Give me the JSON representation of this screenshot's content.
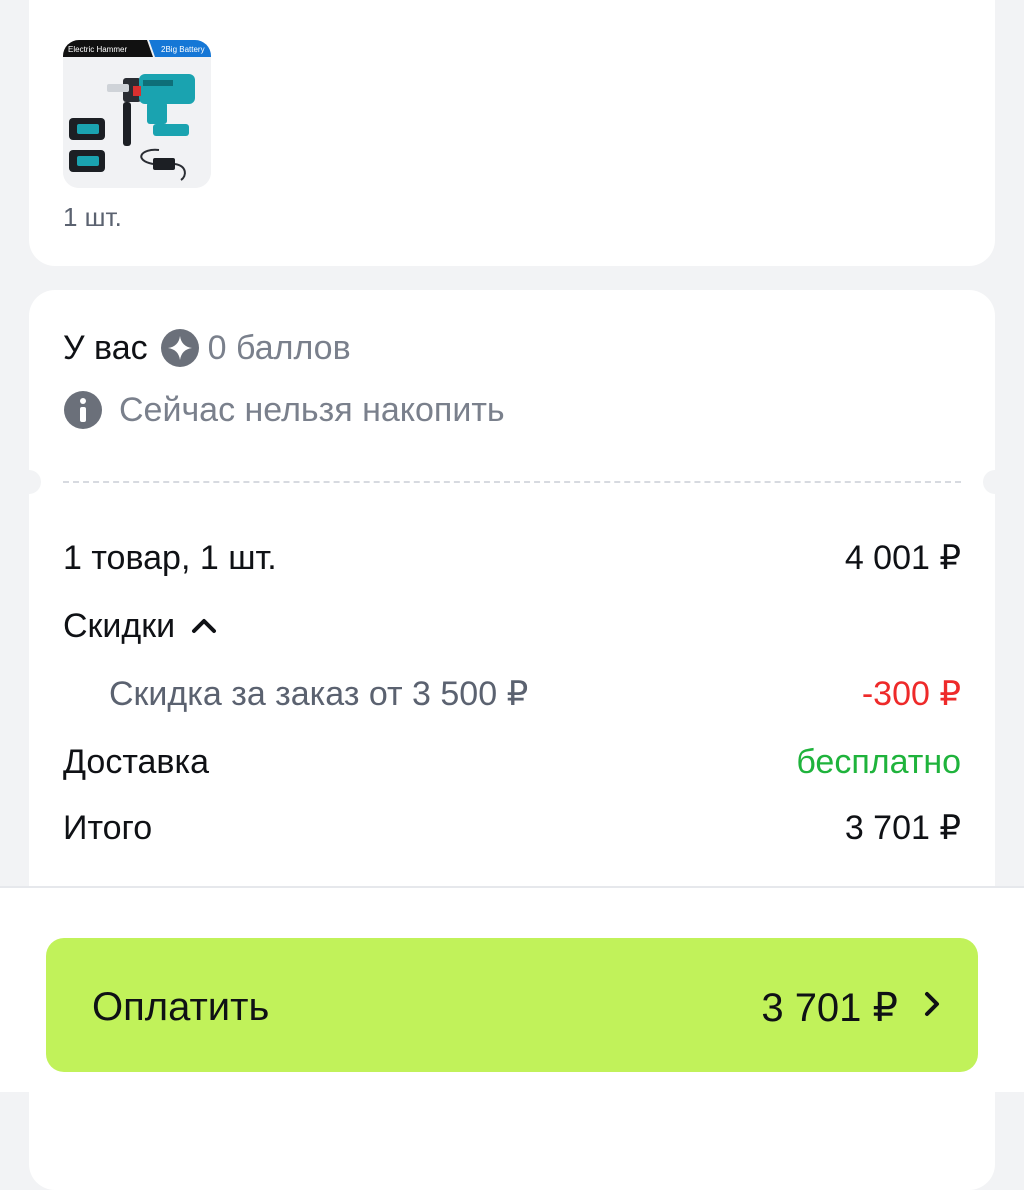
{
  "product": {
    "thumb_badge_left": "Electric Hammer",
    "thumb_badge_right": "2Big Battery",
    "quantity": "1 шт."
  },
  "points": {
    "lead": "У вас",
    "value": "0 баллов",
    "info": "Сейчас нельзя накопить"
  },
  "summary": {
    "items_label": "1 товар, 1 шт.",
    "items_amount": "4 001 ₽",
    "discounts_label": "Скидки",
    "discount_item_label": "Скидка за заказ от 3 500 ₽",
    "discount_item_amount": "-300 ₽",
    "delivery_label": "Доставка",
    "delivery_amount": "бесплатно",
    "total_label": "Итого",
    "total_amount": "3 701 ₽"
  },
  "pay_button": {
    "label": "Оплатить",
    "amount": "3 701 ₽"
  },
  "colors": {
    "page_bg": "#f2f3f5",
    "card_bg": "#ffffff",
    "accent_button": "#c1f25a",
    "discount_red": "#ee2a2a",
    "free_green": "#1fb33c",
    "muted_text": "#7a808c"
  },
  "icons": {
    "coin": "points-coin-icon",
    "info": "info-icon",
    "discounts_toggle": "chevron-up-icon",
    "pay": "chevron-right-icon"
  }
}
